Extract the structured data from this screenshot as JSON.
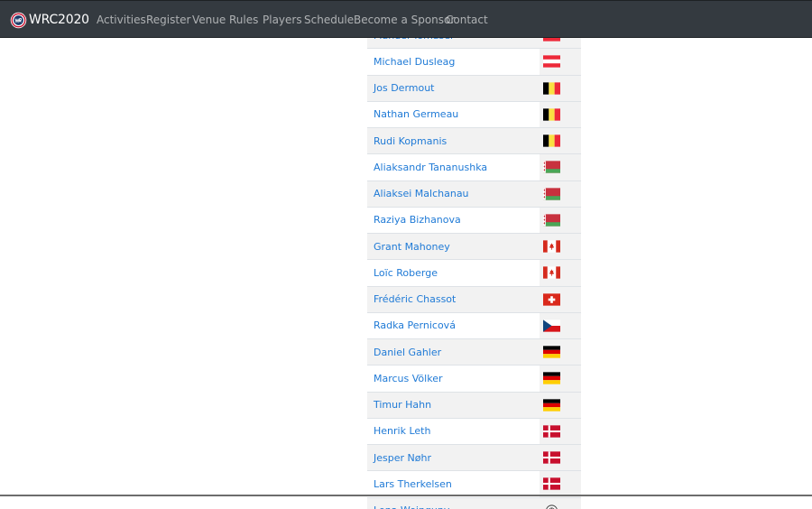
{
  "nav": {
    "brand": "WRC2020",
    "items": [
      "Activities",
      "Register",
      "Venue",
      "Rules",
      "Players",
      "Schedule",
      "Become a Sponsor",
      "Contact"
    ]
  },
  "players": [
    {
      "name": "Manuel Tomaser",
      "flag": "austria-flag-icon"
    },
    {
      "name": "Michael Dusleag",
      "flag": "austria-flag-icon"
    },
    {
      "name": "Jos Dermout",
      "flag": "belgium-flag-icon"
    },
    {
      "name": "Nathan Germeau",
      "flag": "belgium-flag-icon"
    },
    {
      "name": "Rudi Kopmanis",
      "flag": "belgium-flag-icon"
    },
    {
      "name": "Aliaksandr Tananushka",
      "flag": "belarus-flag-icon"
    },
    {
      "name": "Aliaksei Malchanau",
      "flag": "belarus-flag-icon"
    },
    {
      "name": "Raziya Bizhanova",
      "flag": "belarus-flag-icon"
    },
    {
      "name": "Grant Mahoney",
      "flag": "canada-flag-icon"
    },
    {
      "name": "Loïc Roberge",
      "flag": "canada-flag-icon"
    },
    {
      "name": "Frédéric Chassot",
      "flag": "switzerland-flag-icon"
    },
    {
      "name": "Radka Pernicová",
      "flag": "czechia-flag-icon"
    },
    {
      "name": "Daniel Gahler",
      "flag": "germany-flag-icon"
    },
    {
      "name": "Marcus Völker",
      "flag": "germany-flag-icon"
    },
    {
      "name": "Timur Hahn",
      "flag": "germany-flag-icon"
    },
    {
      "name": "Henrik Leth",
      "flag": "denmark-flag-icon"
    },
    {
      "name": "Jesper Nøhr",
      "flag": "denmark-flag-icon"
    },
    {
      "name": "Lars Therkelsen",
      "flag": "denmark-flag-icon"
    },
    {
      "name": "Lena Weinguny",
      "flag": "round-badge-icon"
    }
  ]
}
